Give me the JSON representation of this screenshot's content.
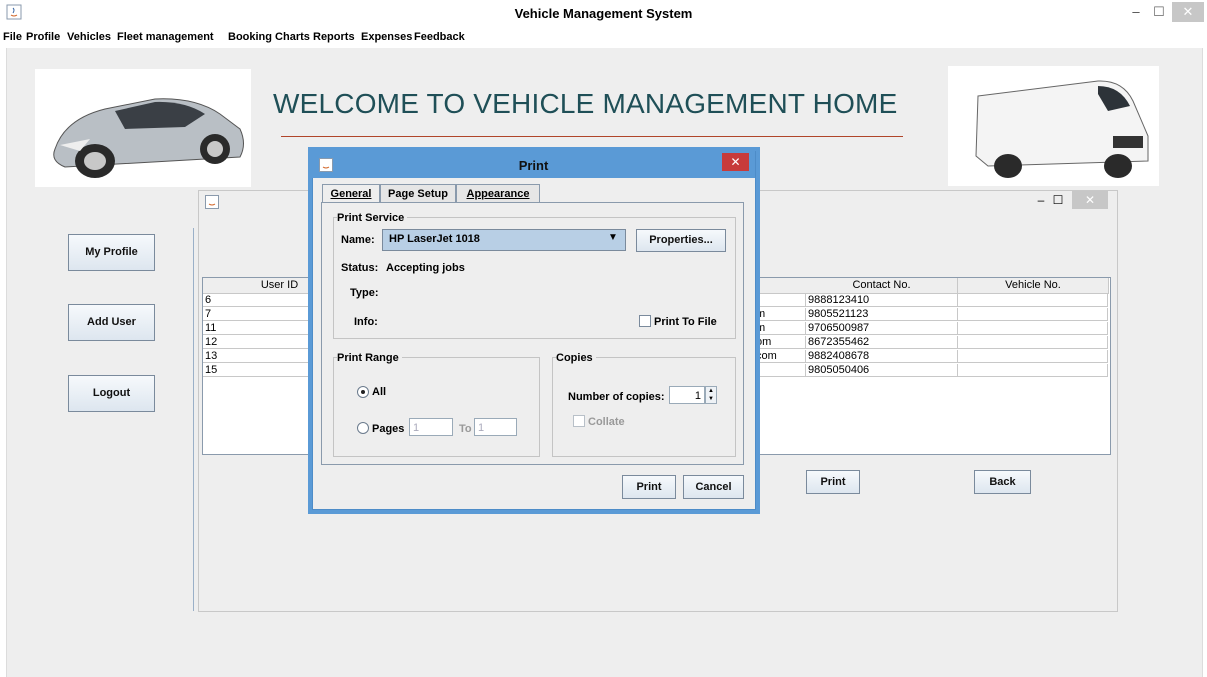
{
  "window": {
    "title": "Vehicle Management System",
    "min": "–",
    "max": "☐",
    "close": "✕"
  },
  "menu": [
    "File",
    "Profile",
    "Vehicles",
    "Fleet management",
    "Booking Charts",
    "Reports",
    "Expenses",
    "Feedback"
  ],
  "welcome": "WELCOME TO VEHICLE MANAGEMENT HOME",
  "sidebar": {
    "my_profile": "My Profile",
    "add_user": "Add User",
    "logout": "Logout"
  },
  "internal_frame": {
    "min": "–",
    "max": "☐",
    "close": "✕"
  },
  "table": {
    "headers": {
      "user_id": "User ID",
      "contact": "Contact No.",
      "vehicle": "Vehicle No."
    },
    "rows": [
      {
        "id": "6",
        "email_tail": "",
        "contact": "9888123410",
        "vehicle": ""
      },
      {
        "id": "7",
        "email_tail": "m",
        "contact": "9805521123",
        "vehicle": ""
      },
      {
        "id": "11",
        "email_tail": "m",
        "contact": "9706500987",
        "vehicle": ""
      },
      {
        "id": "12",
        "email_tail": "om",
        "contact": "8672355462",
        "vehicle": ""
      },
      {
        "id": "13",
        "email_tail": "com",
        "contact": "9882408678",
        "vehicle": ""
      },
      {
        "id": "15",
        "email_tail": "",
        "contact": "9805050406",
        "vehicle": ""
      }
    ]
  },
  "frame_buttons": {
    "print": "Print",
    "back": "Back"
  },
  "print_dialog": {
    "title": "Print",
    "close": "✕",
    "tabs": {
      "general": "General",
      "page_setup": "Page Setup",
      "appearance": "Appearance"
    },
    "print_service": {
      "label": "Print Service",
      "name_label": "Name:",
      "name_value": "HP LaserJet 1018",
      "properties": "Properties...",
      "status_label": "Status:",
      "status_value": "Accepting jobs",
      "type_label": "Type:",
      "info_label": "Info:",
      "print_to_file": "Print To File"
    },
    "print_range": {
      "label": "Print Range",
      "all": "All",
      "pages": "Pages",
      "from": "1",
      "to_label": "To",
      "to": "1"
    },
    "copies": {
      "label": "Copies",
      "number_label": "Number of copies:",
      "value": "1",
      "collate": "Collate"
    },
    "buttons": {
      "print": "Print",
      "cancel": "Cancel"
    }
  }
}
